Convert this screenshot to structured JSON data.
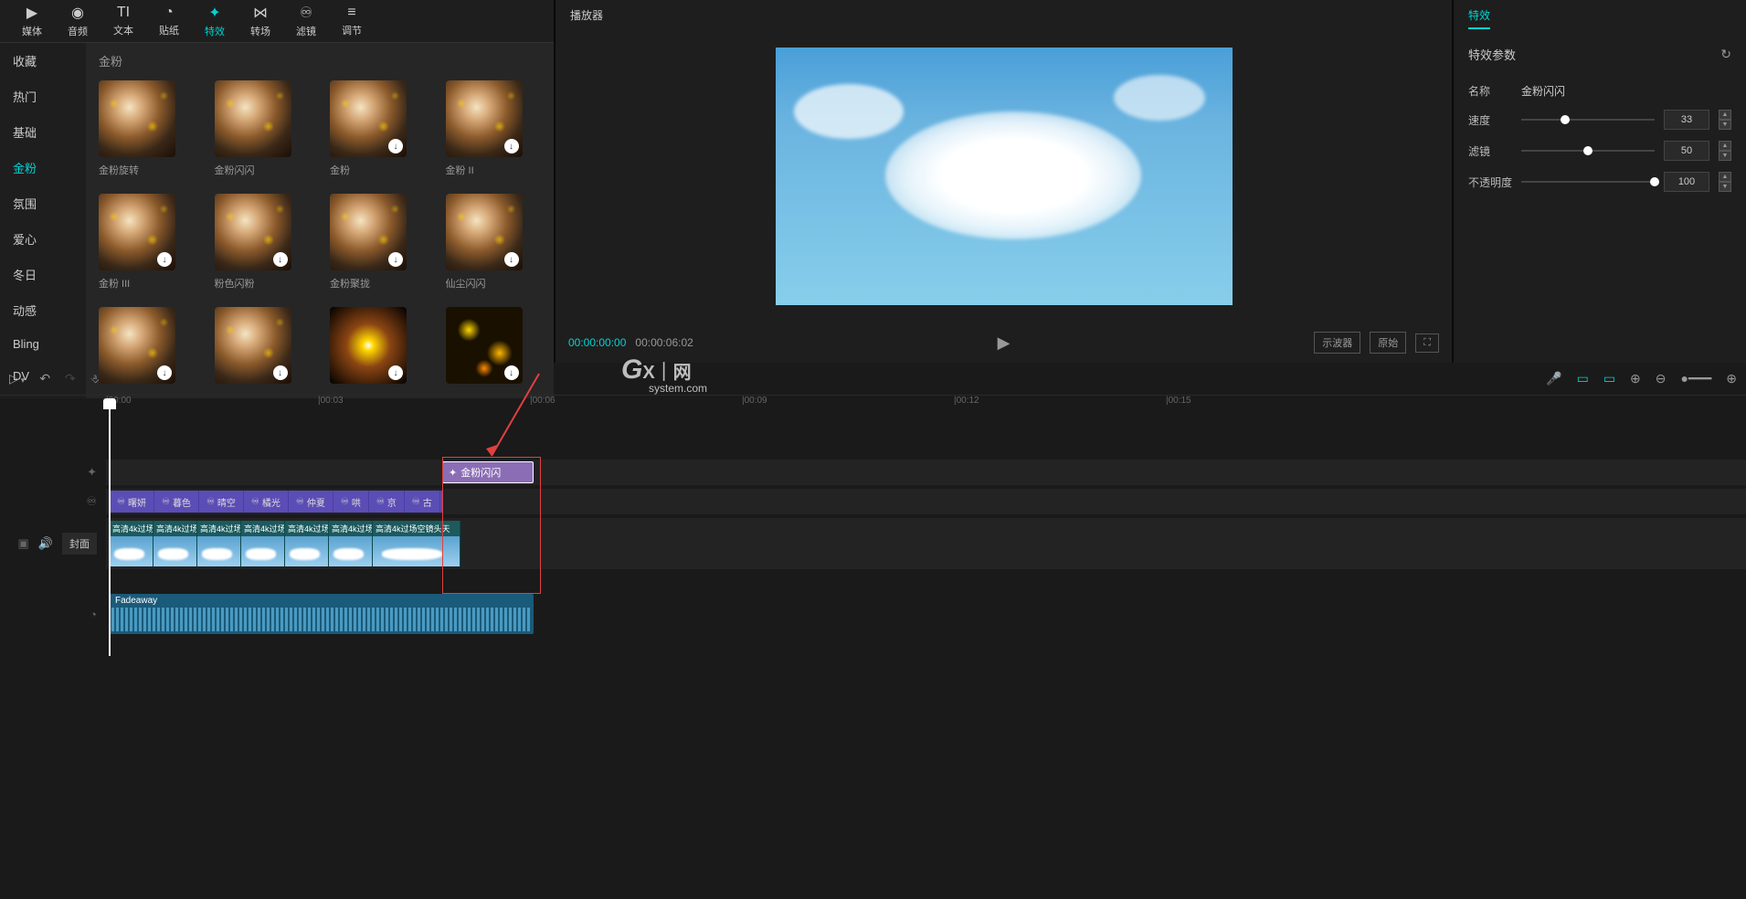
{
  "nav_tabs": [
    {
      "icon": "▶",
      "label": "媒体"
    },
    {
      "icon": "◉",
      "label": "音频"
    },
    {
      "icon": "TI",
      "label": "文本"
    },
    {
      "icon": "◔",
      "label": "贴纸"
    },
    {
      "icon": "✦",
      "label": "特效",
      "active": true
    },
    {
      "icon": "⋈",
      "label": "转场"
    },
    {
      "icon": "♾",
      "label": "滤镜"
    },
    {
      "icon": "≡",
      "label": "调节"
    }
  ],
  "categories": [
    {
      "label": "收藏"
    },
    {
      "label": "热门"
    },
    {
      "label": "基础"
    },
    {
      "label": "金粉",
      "active": true
    },
    {
      "label": "氛围"
    },
    {
      "label": "爱心"
    },
    {
      "label": "冬日"
    },
    {
      "label": "动感"
    },
    {
      "label": "Bling"
    },
    {
      "label": "DV"
    }
  ],
  "grid_title": "金粉",
  "effects": [
    {
      "label": "金粉旋转",
      "download": false,
      "variant": "sparkle"
    },
    {
      "label": "金粉闪闪",
      "download": false,
      "variant": "sparkle"
    },
    {
      "label": "金粉",
      "download": true,
      "variant": "sparkle"
    },
    {
      "label": "金粉 II",
      "download": true,
      "variant": "sparkle"
    },
    {
      "label": "金粉 III",
      "download": true,
      "variant": "sparkle"
    },
    {
      "label": "粉色闪粉",
      "download": true,
      "variant": "sparkle"
    },
    {
      "label": "金粉聚拢",
      "download": true,
      "variant": "sparkle"
    },
    {
      "label": "仙尘闪闪",
      "download": true,
      "variant": "sparkle"
    },
    {
      "label": "",
      "download": true,
      "variant": "sparkle"
    },
    {
      "label": "",
      "download": true,
      "variant": "sparkle"
    },
    {
      "label": "",
      "download": true,
      "variant": "burst"
    },
    {
      "label": "",
      "download": true,
      "variant": "bokeh"
    }
  ],
  "player": {
    "title": "播放器",
    "current_time": "00:00:00:00",
    "total_time": "00:00:06:02",
    "scope_btn": "示波器",
    "original_btn": "原始"
  },
  "fx_panel": {
    "tab": "特效",
    "params_title": "特效参数",
    "name_label": "名称",
    "name_value": "金粉闪闪",
    "sliders": [
      {
        "label": "速度",
        "value": 33,
        "max": 100
      },
      {
        "label": "滤镜",
        "value": 50,
        "max": 100
      },
      {
        "label": "不透明度",
        "value": 100,
        "max": 100
      }
    ]
  },
  "ruler_marks": [
    {
      "label": "|00:00",
      "pos": 0
    },
    {
      "label": "|00:03",
      "pos": 232
    },
    {
      "label": "|00:06",
      "pos": 464
    },
    {
      "label": "|00:09",
      "pos": 696
    },
    {
      "label": "|00:12",
      "pos": 928
    },
    {
      "label": "|00:15",
      "pos": 1160
    }
  ],
  "timeline": {
    "effect_clip_label": "金粉闪闪",
    "filter_segments": [
      "曙妍",
      "暮色",
      "晴空",
      "橘光",
      "仲夏",
      "哄",
      "京",
      "古"
    ],
    "video_clip_label": "高清4k过场空",
    "video_clip_label_last": "高清4k过场空镜头天",
    "video_clip_count": 7,
    "cover_btn": "封面",
    "audio_label": "Fadeaway"
  },
  "watermark": {
    "prefix": "G",
    "text": "X｜网",
    "sub": "system.com"
  }
}
